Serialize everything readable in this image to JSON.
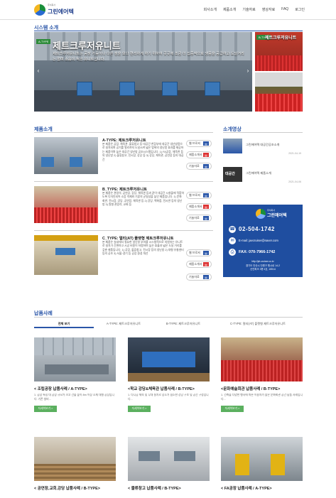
{
  "header": {
    "logo_small": "주식회사",
    "logo_name": "그린에어텍",
    "nav": [
      "회사소개",
      "제품소개",
      "기술자료",
      "영상자료",
      "FAQ",
      "로그인"
    ]
  },
  "system": {
    "title": "시스템 소개",
    "badge": "A-TYPE",
    "hero_title": "제트크루저유니트",
    "hero_sub": "제트크루저유니트는 공장 가동이나 다른 점을 보다 편리하게 하기 위하여 곳곳에 조금 더 집중적으로 냉풍을 공급하고 도달거리는 멀며 소음이 적은 유니트입니다.",
    "side_title": "제트크루저유니트",
    "side_badge": "B-TYPE",
    "arrow_left": "‹",
    "arrow_right": "›"
  },
  "products": {
    "title": "제품소개",
    "items": [
      {
        "name": "A-TYPE: 제트크루저유니트",
        "desc": "본 제품은 공장, 체육관, 물류창고 등 대공간 천장부에 대공간 냉난방용으로 설치되며 공기를 멀리까지 도달시켜 넓은 범위의 냉난방 효과를 제공하는 제품이며 높은 대공간 냉난방 공조시스템입니다.\n1) FA공장, 체육관 등의 냉난방\n2) 물류창고, 전시장, 강당 등\n3) 강당, 체육관, 공연장 등의 대공간",
        "buttons": [
          "웹 브로셔",
          "제품소개서",
          "기술자료"
        ]
      },
      {
        "name": "B_TYPE: 제트크루저유니트",
        "desc": "본 제품은 관람석, 공연장, 강당, 체육관 등과 같이 대공간 시설물에 적합하도록 디자인되어 소음 억제와 기류의 균일성을 높인 제품입니다.\n1) 문화회관, 전시장, 강당, 공연장, 체육관 등\n2) 강당, 백화점, 전시관 등의 냉난방\n3) 원형 관람석, 교회 등",
        "buttons": [
          "웹 브로셔",
          "제품소개서",
          "기술자료"
        ]
      },
      {
        "name": "C_TYPE: 멀티(AT) 플랫형 제트크루저유니트",
        "desc": "본 제품은 실내에서 필요한 냉난방 부하를 시스템적으로 지원하는 유니트로 설치가 간편하고 시공 비용이 저렴하며 높은 효율과 넓은 도달 거리를 갖춘 제품입니다.\n1) 공장, 물류창고, 전시장 등의 냉난방\n2) 대형 유통센터 등의 공조\n3) 서울·경기 등 공장 환경 개선",
        "buttons": [
          "웹 브로셔",
          "제품소개서",
          "기술자료"
        ]
      }
    ]
  },
  "videos": {
    "title": "소개영상",
    "items": [
      {
        "title": "그린에어텍 대공간공조소개",
        "date": "2021-04-19"
      },
      {
        "title": "그린에어텍 제품소개",
        "date": "2021-04-06",
        "thumb_text": "대공간"
      }
    ]
  },
  "contact": {
    "logo_small": "주식회사",
    "logo_name": "그린에어텍",
    "phone": "02-504-1742",
    "email": "E-mail: jaecruiser@naver.com",
    "fax": "FAX: 070-7966-1742",
    "url": "http://jet-cruiser.co.kr",
    "address": "경기도 안산시 단원구 원시로 14-2\n신안파크 3층 4호, 15514"
  },
  "cases": {
    "title": "납품사례",
    "tabs": [
      "전체 보기",
      "A-TYPE: 제트크루저유니트",
      "B-TYPE: 제트크루저유니트",
      "C-TYPE: 멀티(AT) 플랫형 제트크루저유니트"
    ],
    "more": "자세히보기 >",
    "items": [
      {
        "title": "< 조립공장 납품사례 / A-TYPE>",
        "desc": "1. 공장 특징 대 공장 규모가 크고 건물 높이 8m 이상 소재 대형 공장입니다. 기존 설비..."
      },
      {
        "title": "<학교 강당&체육관 납품사례 / B-TYPE>",
        "desc": "1. 다니공 체육 및 무대 설치로 장소가 협소한 강당 구조 및 공간 구성입니다..."
      },
      {
        "title": "<문화예술회관 납품사례 / B-TYPE>",
        "desc": "1. 건축물 다양한 행사에 따른 이용자가 많은 문화회관 공간 납품 사례입니다..."
      },
      {
        "title": "< 공연장,교회,강당 납품사례 / B-TYPE>",
        "desc": ""
      },
      {
        "title": "< 물류창고 납품사례 / B-TYPE>",
        "desc": ""
      },
      {
        "title": "< FA공장 납품사례 / A-TYPE>",
        "desc": ""
      }
    ]
  },
  "colors": {
    "brand_blue": "#2a56a8",
    "accent_green": "#2e8b3a",
    "contact_bg": "#1f4ea0"
  }
}
